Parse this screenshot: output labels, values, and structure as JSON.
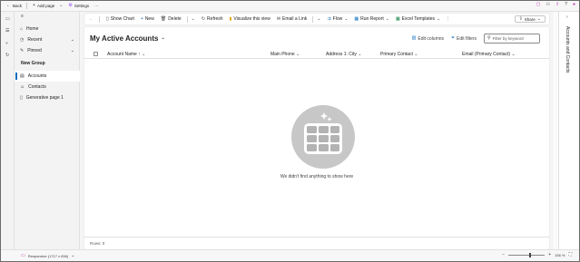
{
  "topbar": {
    "back_label": "Back",
    "add_page_label": "Add page",
    "settings_label": "Settings",
    "more_label": "···"
  },
  "nav": {
    "items": [
      {
        "label": "Home"
      },
      {
        "label": "Recent"
      },
      {
        "label": "Pinned"
      }
    ],
    "group_label": "New Group",
    "group_items": [
      {
        "label": "Accounts"
      },
      {
        "label": "Contacts"
      },
      {
        "label": "Generative page 1"
      }
    ]
  },
  "commandbar": {
    "show_chart": "Show Chart",
    "new": "New",
    "delete": "Delete",
    "refresh": "Refresh",
    "visualize": "Visualize this view",
    "email_link": "Email a Link",
    "flow": "Flow",
    "run_report": "Run Report",
    "excel_templates": "Excel Templates",
    "share": "Share"
  },
  "view": {
    "title": "My Active Accounts",
    "edit_columns": "Edit columns",
    "edit_filters": "Edit filters",
    "filter_placeholder": "Filter by keyword",
    "columns": [
      {
        "label": "Account Name ↑"
      },
      {
        "label": "Main Phone"
      },
      {
        "label": "Address 1: City"
      },
      {
        "label": "Primary Contact"
      },
      {
        "label": "Email (Primary Contact)"
      }
    ],
    "empty_text": "We didn't find anything to show here",
    "rows_label": "Rows: 0"
  },
  "side_pane": {
    "title": "Accounts and Contacts"
  },
  "statusbar": {
    "responsive_label": "Responsive (1717 x 836)",
    "zoom_value": "156 %",
    "zoom_level": 0.56
  },
  "colors": {
    "accent": "#0f6cbd",
    "empty_circle": "#c7c7c7"
  }
}
